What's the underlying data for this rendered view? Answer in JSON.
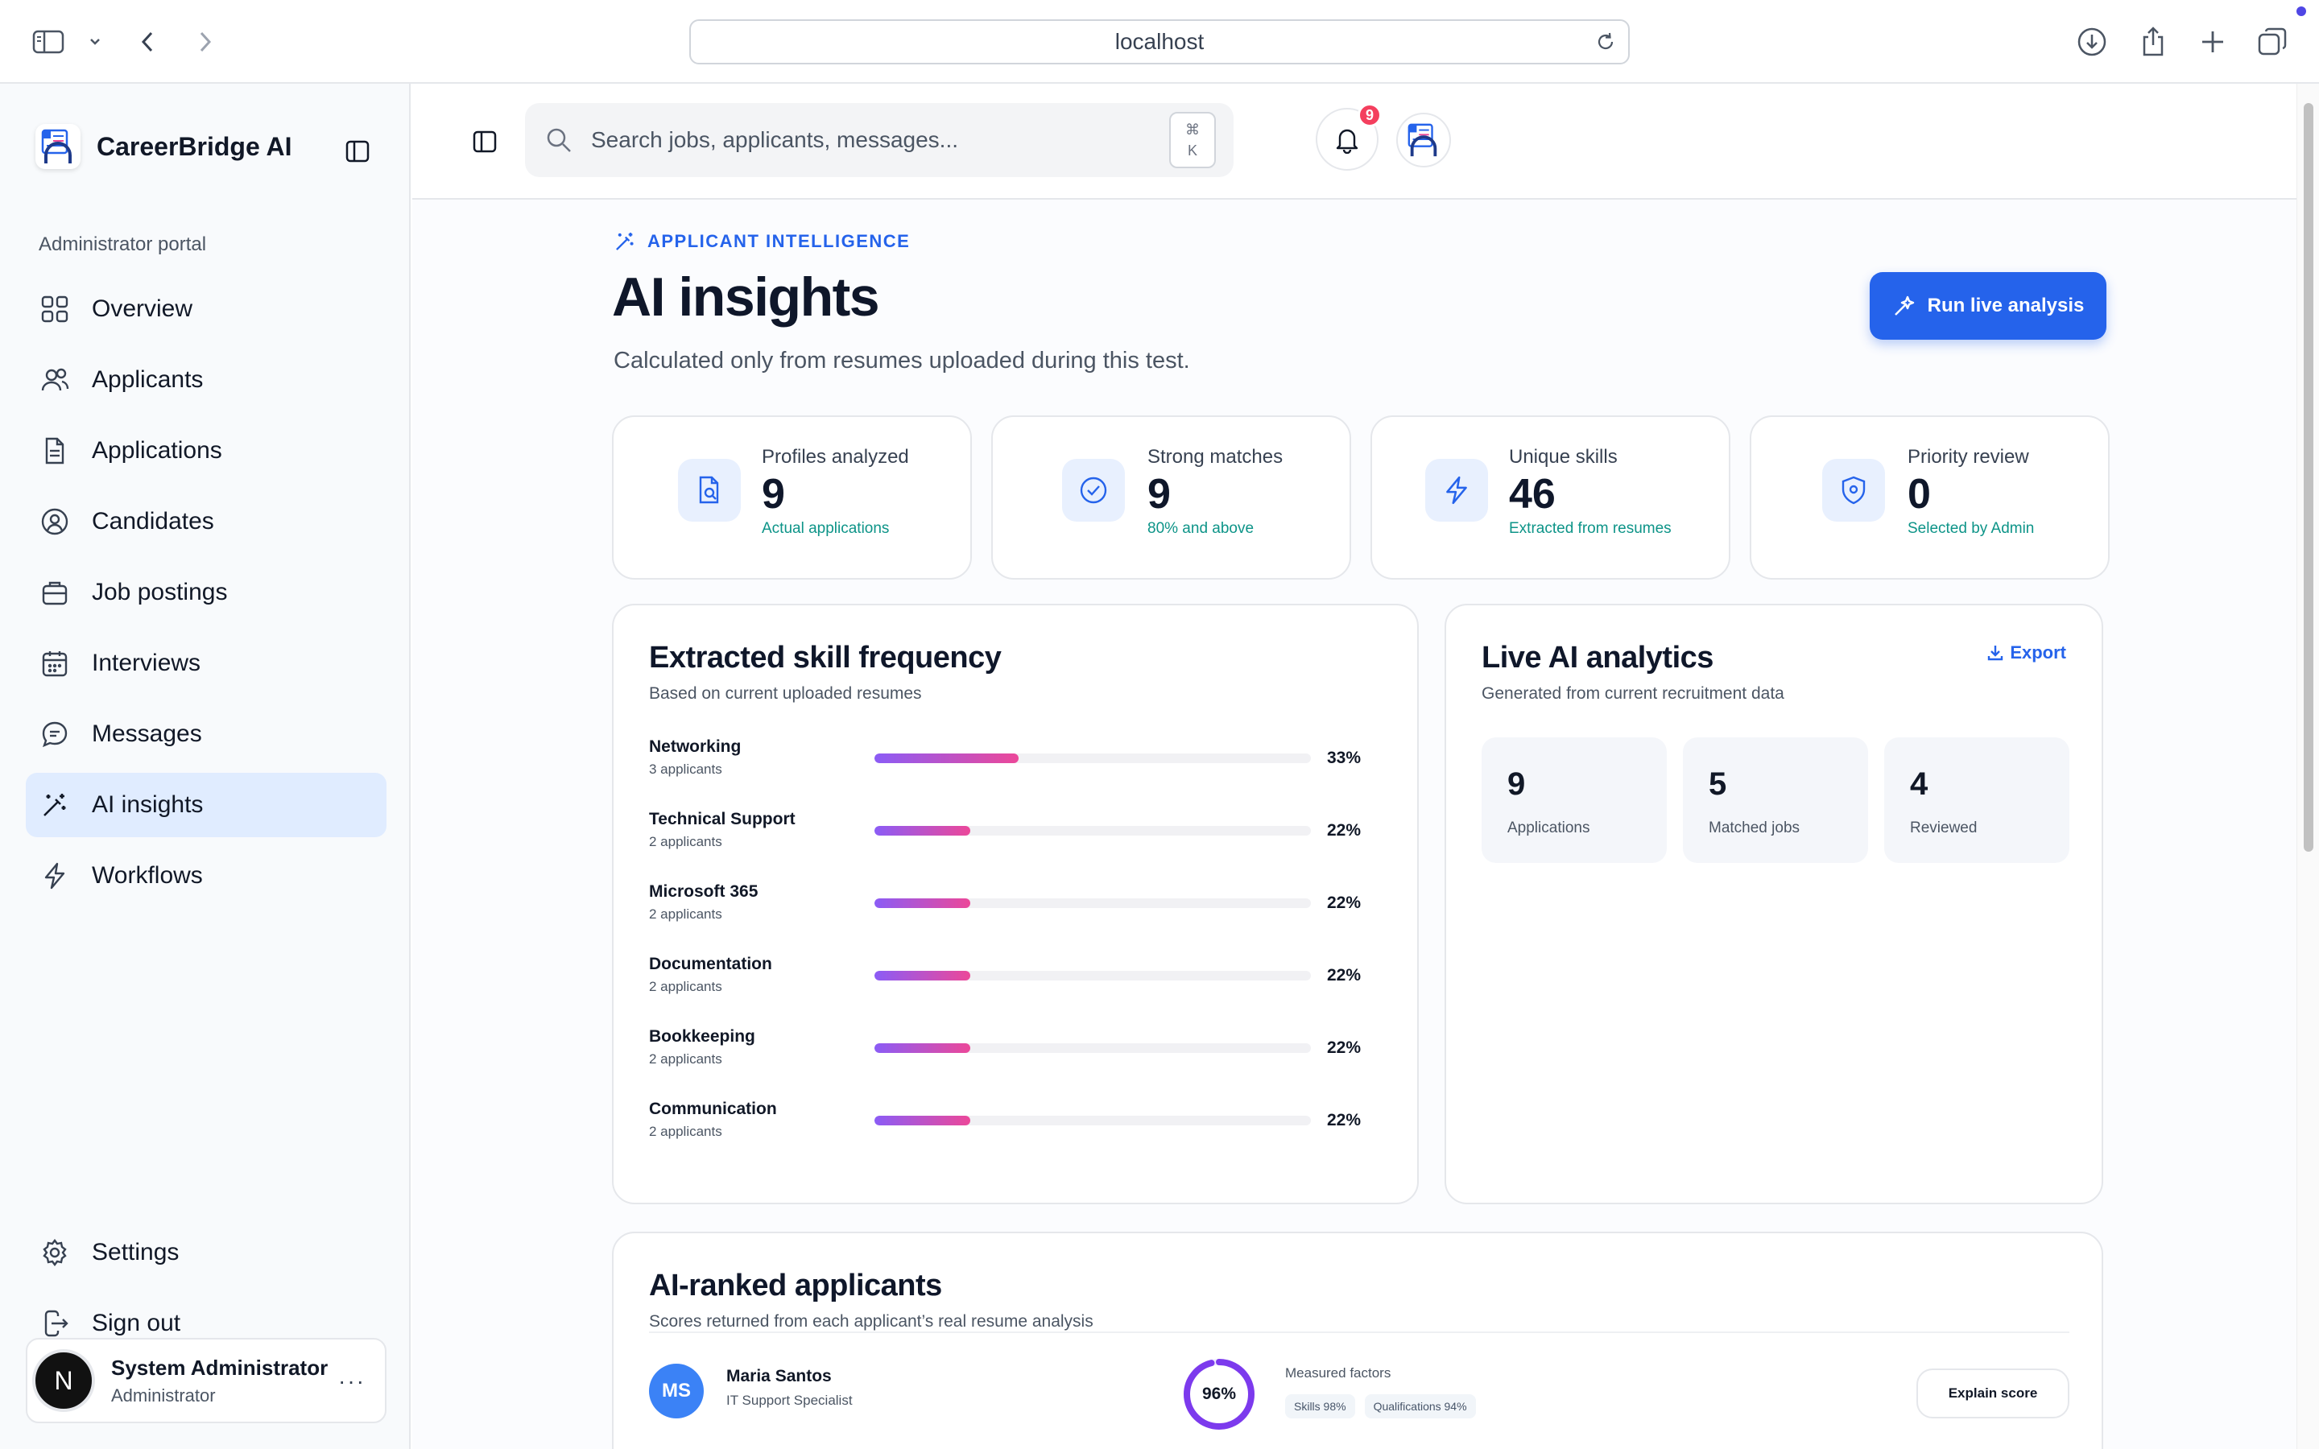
{
  "browser": {
    "url": "localhost"
  },
  "sidebar": {
    "brand": "CareerBridge AI",
    "portal_label": "Administrator portal",
    "items": [
      {
        "label": "Overview",
        "icon": "grid-icon"
      },
      {
        "label": "Applicants",
        "icon": "users-icon"
      },
      {
        "label": "Applications",
        "icon": "document-icon"
      },
      {
        "label": "Candidates",
        "icon": "user-circle-icon"
      },
      {
        "label": "Job postings",
        "icon": "briefcase-icon"
      },
      {
        "label": "Interviews",
        "icon": "calendar-icon"
      },
      {
        "label": "Messages",
        "icon": "chat-icon"
      },
      {
        "label": "AI insights",
        "icon": "magic-wand-icon",
        "active": true
      },
      {
        "label": "Workflows",
        "icon": "lightning-icon"
      }
    ],
    "bottom": [
      {
        "label": "Settings",
        "icon": "gear-icon"
      },
      {
        "label": "Sign out",
        "icon": "sign-out-icon"
      }
    ],
    "user": {
      "initial": "N",
      "name": "System Administrator",
      "role": "Administrator",
      "more": "···"
    }
  },
  "topbar": {
    "search_placeholder": "Search jobs, applicants, messages...",
    "shortcut_symbol": "⌘",
    "shortcut_key": "K",
    "notification_count": "9"
  },
  "page": {
    "eyebrow": "APPLICANT INTELLIGENCE",
    "title": "AI insights",
    "subtitle": "Calculated only from resumes uploaded during this test.",
    "run_button": "Run live analysis"
  },
  "stats": [
    {
      "label": "Profiles analyzed",
      "value": "9",
      "note": "Actual applications",
      "icon": "document-search-icon"
    },
    {
      "label": "Strong matches",
      "value": "9",
      "note": "80% and above",
      "icon": "check-circle-icon"
    },
    {
      "label": "Unique skills",
      "value": "46",
      "note": "Extracted from resumes",
      "icon": "lightning-icon"
    },
    {
      "label": "Priority review",
      "value": "0",
      "note": "Selected by Admin",
      "icon": "shield-icon"
    }
  ],
  "skills_card": {
    "title": "Extracted skill frequency",
    "subtitle": "Based on current uploaded resumes",
    "skills": [
      {
        "name": "Networking",
        "count": "3 applicants",
        "pct_label": "33%",
        "pct": 33
      },
      {
        "name": "Technical Support",
        "count": "2 applicants",
        "pct_label": "22%",
        "pct": 22
      },
      {
        "name": "Microsoft 365",
        "count": "2 applicants",
        "pct_label": "22%",
        "pct": 22
      },
      {
        "name": "Documentation",
        "count": "2 applicants",
        "pct_label": "22%",
        "pct": 22
      },
      {
        "name": "Bookkeeping",
        "count": "2 applicants",
        "pct_label": "22%",
        "pct": 22
      },
      {
        "name": "Communication",
        "count": "2 applicants",
        "pct_label": "22%",
        "pct": 22
      }
    ]
  },
  "analytics_card": {
    "title": "Live AI analytics",
    "subtitle": "Generated from current recruitment data",
    "export_label": "Export",
    "metrics": [
      {
        "value": "9",
        "label": "Applications"
      },
      {
        "value": "5",
        "label": "Matched jobs"
      },
      {
        "value": "4",
        "label": "Reviewed"
      }
    ]
  },
  "ranked_card": {
    "title": "AI-ranked applicants",
    "subtitle": "Scores returned from each applicant’s real resume analysis",
    "applicants": [
      {
        "initials": "MS",
        "name": "Maria Santos",
        "role": "IT Support Specialist",
        "score_label": "96%",
        "score": 96,
        "factors_title": "Measured factors",
        "factors": [
          "Skills 98%",
          "Qualifications 94%"
        ],
        "action": "Explain score"
      }
    ]
  },
  "colors": {
    "accent": "#2563eb",
    "active_nav": "#e0ecff",
    "note_teal": "#0d9488",
    "badge": "#f43f5e",
    "bar_start": "#8b5cf6",
    "bar_end": "#ec4899",
    "score_ring": "#7c3aed"
  }
}
